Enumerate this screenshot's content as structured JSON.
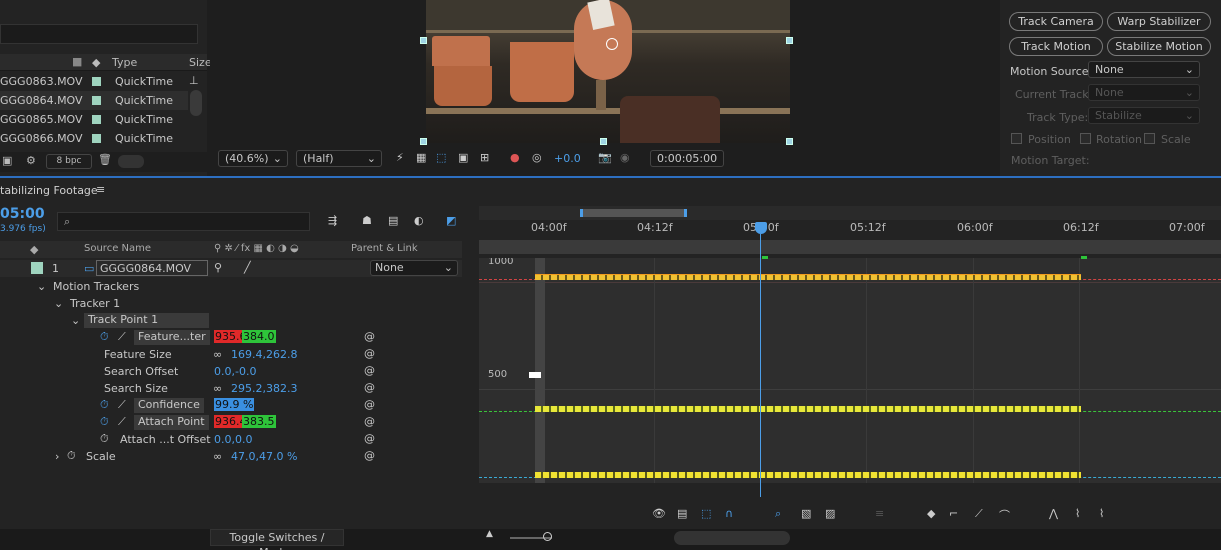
{
  "project": {
    "columns": {
      "type": "Type",
      "size": "Size"
    },
    "files": [
      {
        "name": "GGG0863.MOV",
        "type": "QuickTime"
      },
      {
        "name": "GGG0864.MOV",
        "type": "QuickTime"
      },
      {
        "name": "GGG0865.MOV",
        "type": "QuickTime"
      },
      {
        "name": "GGG0866.MOV",
        "type": "QuickTime"
      }
    ],
    "bpc": "8 bpc"
  },
  "viewer": {
    "zoom": "(40.6%)",
    "resolution": "(Half)",
    "exposure": "+0.0",
    "timecode": "0:00:05:00"
  },
  "tracker": {
    "track_camera": "Track Camera",
    "warp_stabilizer": "Warp Stabilizer",
    "track_motion": "Track Motion",
    "stabilize_motion": "Stabilize Motion",
    "motion_source_label": "Motion Source:",
    "motion_source_value": "None",
    "current_track_label": "Current Track:",
    "current_track_value": "None",
    "track_type_label": "Track Type:",
    "track_type_value": "Stabilize",
    "position": "Position",
    "rotation": "Rotation",
    "scale": "Scale",
    "motion_target_label": "Motion Target:"
  },
  "timeline": {
    "title": "tabilizing Footage",
    "current_time": "05:00",
    "fps": "3.976 fps)",
    "source_name_header": "Source Name",
    "parent_link_header": "Parent & Link",
    "layer_number": "1",
    "layer_name": "GGGG0864.MOV",
    "parent_value": "None",
    "motion_trackers": "Motion Trackers",
    "tracker1": "Tracker 1",
    "track_point": "Track Point 1",
    "feature_center_label": "Feature...ter",
    "feature_center_x": "935.6",
    "feature_center_y": "384.0",
    "feature_size_label": "Feature Size",
    "feature_size_value": "169.4,262.8",
    "search_offset_label": "Search Offset",
    "search_offset_value": "0.0,-0.0",
    "search_size_label": "Search Size",
    "search_size_value": "295.2,382.3",
    "confidence_label": "Confidence",
    "confidence_value": "99.9 %",
    "attach_point_label": "Attach Point",
    "attach_point_x": "936.4",
    "attach_point_y": "383.5",
    "attach_offset_label": "Attach ...t Offset",
    "attach_offset_value": "0.0,0.0",
    "scale_label": "Scale",
    "scale_value": "47.0,47.0 %",
    "ruler": [
      "04:00f",
      "04:12f",
      "05:00f",
      "05:12f",
      "06:00f",
      "06:12f",
      "07:00f"
    ],
    "graph_label_top": "1000",
    "graph_label_mid": "500",
    "toggle_label": "Toggle Switches / Modes"
  }
}
